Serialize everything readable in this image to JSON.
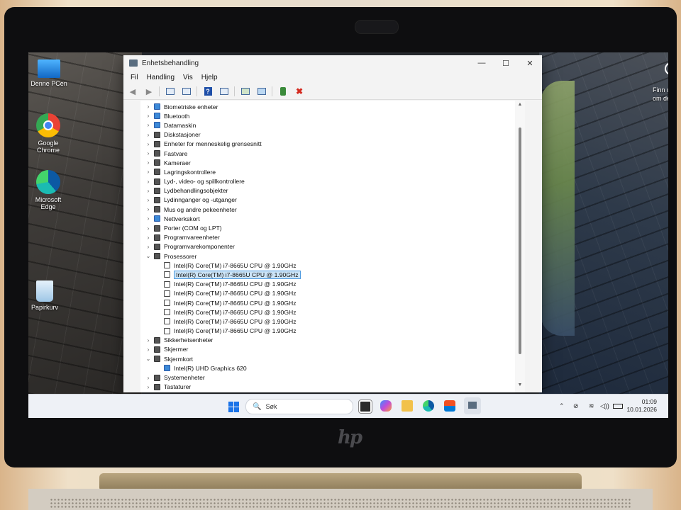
{
  "desktop": {
    "icons": [
      {
        "label": "Denne PCen"
      },
      {
        "label": "Google Chrome"
      },
      {
        "label": "Microsoft Edge"
      },
      {
        "label": "Papirkurv"
      }
    ],
    "corner_text_line1": "Finn ut",
    "corner_text_line2": "om dette"
  },
  "window": {
    "title": "Enhetsbehandling",
    "controls": {
      "minimize": "—",
      "maximize": "☐",
      "close": "✕"
    },
    "menu": [
      "Fil",
      "Handling",
      "Vis",
      "Hjelp"
    ],
    "toolbar_icons": [
      "back-arrow",
      "forward-arrow",
      "properties",
      "console",
      "help",
      "view",
      "update-driver",
      "scan",
      "enable",
      "uninstall"
    ]
  },
  "tree": {
    "rows": [
      {
        "label": "Biometriske enheter",
        "expanded": false,
        "level": 0
      },
      {
        "label": "Bluetooth",
        "expanded": false,
        "level": 0
      },
      {
        "label": "Datamaskin",
        "expanded": false,
        "level": 0
      },
      {
        "label": "Diskstasjoner",
        "expanded": false,
        "level": 0
      },
      {
        "label": "Enheter for menneskelig grensesnitt",
        "expanded": false,
        "level": 0
      },
      {
        "label": "Fastvare",
        "expanded": false,
        "level": 0
      },
      {
        "label": "Kameraer",
        "expanded": false,
        "level": 0
      },
      {
        "label": "Lagringskontrollere",
        "expanded": false,
        "level": 0
      },
      {
        "label": "Lyd-, video- og spillkontrollere",
        "expanded": false,
        "level": 0
      },
      {
        "label": "Lydbehandlingsobjekter",
        "expanded": false,
        "level": 0
      },
      {
        "label": "Lydinnganger og -utganger",
        "expanded": false,
        "level": 0
      },
      {
        "label": "Mus og andre pekeenheter",
        "expanded": false,
        "level": 0
      },
      {
        "label": "Nettverkskort",
        "expanded": false,
        "level": 0
      },
      {
        "label": "Porter (COM og LPT)",
        "expanded": false,
        "level": 0
      },
      {
        "label": "Programvareenheter",
        "expanded": false,
        "level": 0
      },
      {
        "label": "Programvarekomponenter",
        "expanded": false,
        "level": 0
      },
      {
        "label": "Prosessorer",
        "expanded": true,
        "level": 0
      },
      {
        "label": "Intel(R) Core(TM) i7-8665U CPU @ 1.90GHz",
        "level": 1
      },
      {
        "label": "Intel(R) Core(TM) i7-8665U CPU @ 1.90GHz",
        "level": 1,
        "selected": true
      },
      {
        "label": "Intel(R) Core(TM) i7-8665U CPU @ 1.90GHz",
        "level": 1
      },
      {
        "label": "Intel(R) Core(TM) i7-8665U CPU @ 1.90GHz",
        "level": 1
      },
      {
        "label": "Intel(R) Core(TM) i7-8665U CPU @ 1.90GHz",
        "level": 1
      },
      {
        "label": "Intel(R) Core(TM) i7-8665U CPU @ 1.90GHz",
        "level": 1
      },
      {
        "label": "Intel(R) Core(TM) i7-8665U CPU @ 1.90GHz",
        "level": 1
      },
      {
        "label": "Intel(R) Core(TM) i7-8665U CPU @ 1.90GHz",
        "level": 1
      },
      {
        "label": "Sikkerhetsenheter",
        "expanded": false,
        "level": 0
      },
      {
        "label": "Skjermer",
        "expanded": false,
        "level": 0
      },
      {
        "label": "Skjermkort",
        "expanded": true,
        "level": 0
      },
      {
        "label": "Intel(R) UHD Graphics 620",
        "level": 1
      },
      {
        "label": "Systemenheter",
        "expanded": false,
        "level": 0
      },
      {
        "label": "Tastaturer",
        "expanded": false,
        "level": 0
      }
    ]
  },
  "taskbar": {
    "search_placeholder": "Søk",
    "time": "01:09",
    "date": "10.01.2026"
  },
  "brand": {
    "laptop_logo": "hp"
  }
}
